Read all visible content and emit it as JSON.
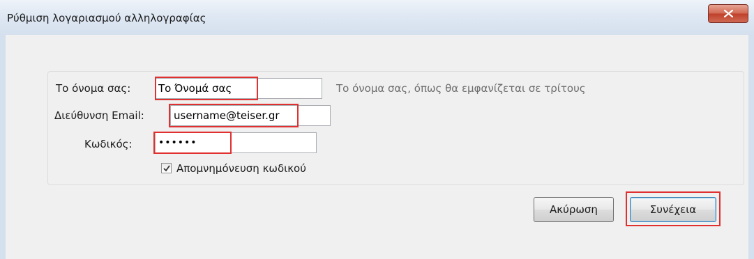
{
  "window": {
    "title": "Ρύθμιση λογαριασμού αλληλογραφίας",
    "close_glyph": "x"
  },
  "form": {
    "name": {
      "label": "Το όνομα σας:",
      "value": "Το Όνομά σας",
      "hint": "Το όνομα σας, όπως θα εμφανίζεται σε τρίτους"
    },
    "email": {
      "label": "Διεύθυνση Email:",
      "value": "username@teiser.gr"
    },
    "password": {
      "label": "Κωδικός:",
      "value": "••••••"
    },
    "remember": {
      "label": "Απομνημόνευση κωδικού",
      "checked": true
    }
  },
  "buttons": {
    "cancel": "Ακύρωση",
    "continue": "Συνέχεια"
  },
  "colors": {
    "highlight": "#e03030",
    "close": "#c0402b"
  }
}
